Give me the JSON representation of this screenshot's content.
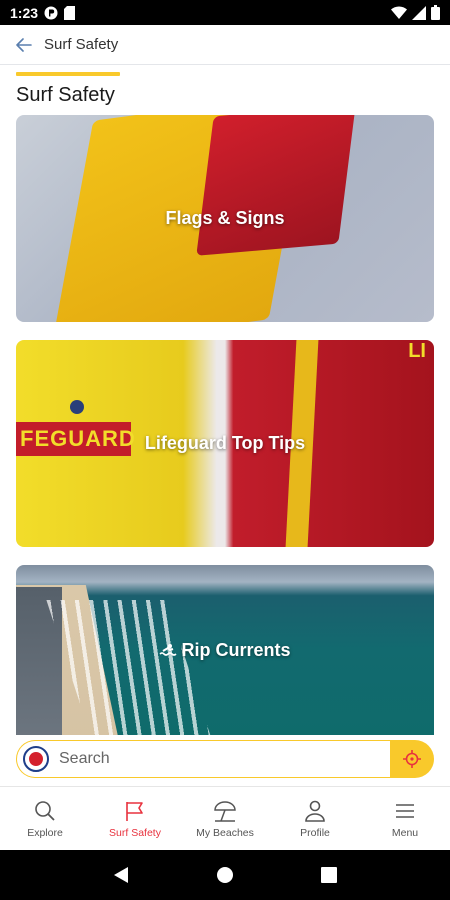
{
  "status_bar": {
    "time": "1:23"
  },
  "app_bar": {
    "title": "Surf Safety"
  },
  "page": {
    "heading": "Surf Safety"
  },
  "cards": [
    {
      "label": "Flags & Signs"
    },
    {
      "label": "Lifeguard Top Tips",
      "shirt_text": "FEGUARD",
      "corner_text": "LI"
    },
    {
      "label": "Rip Currents"
    }
  ],
  "search": {
    "placeholder": "Search"
  },
  "bottom_nav": {
    "items": [
      {
        "label": "Explore",
        "icon": "search-icon"
      },
      {
        "label": "Surf Safety",
        "icon": "flag-icon",
        "active": true
      },
      {
        "label": "My Beaches",
        "icon": "umbrella-icon"
      },
      {
        "label": "Profile",
        "icon": "person-icon"
      },
      {
        "label": "Menu",
        "icon": "hamburger-icon"
      }
    ]
  },
  "colors": {
    "accent": "#f9c92b",
    "active_nav": "#e8323e"
  }
}
